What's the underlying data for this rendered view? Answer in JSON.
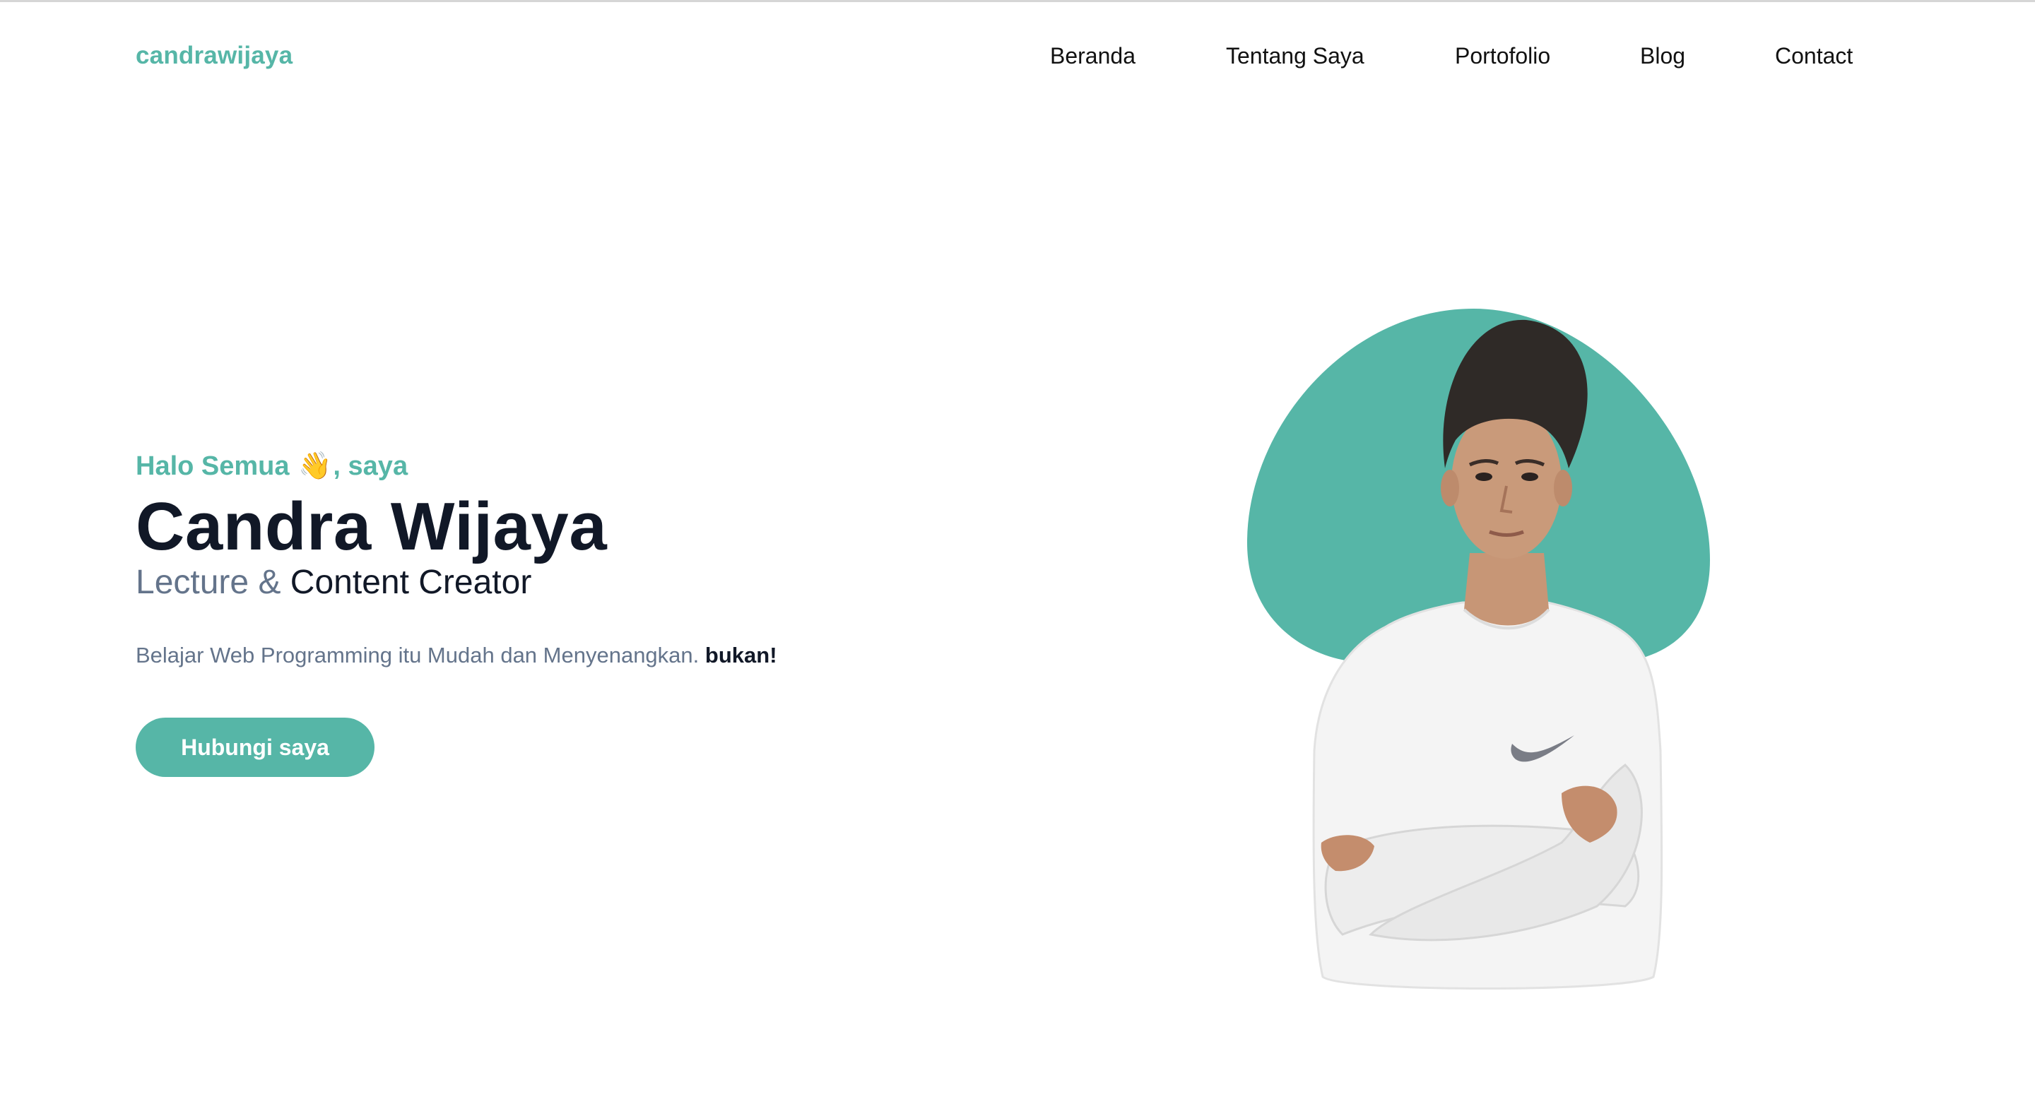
{
  "colors": {
    "accent": "#56b6a7",
    "heading": "#111827",
    "muted": "#64748b",
    "text": "#111111",
    "background": "#ffffff"
  },
  "navbar": {
    "logo": "candrawijaya",
    "links": [
      {
        "label": "Beranda"
      },
      {
        "label": "Tentang Saya"
      },
      {
        "label": "Portofolio"
      },
      {
        "label": "Blog"
      },
      {
        "label": "Contact"
      }
    ]
  },
  "hero": {
    "greeting_prefix": "Halo Semua",
    "greeting_emoji": "👋",
    "greeting_suffix": ", saya",
    "name": "Candra Wijaya",
    "role_part1": "Lecture &",
    "role_part2": "Content Creator",
    "tagline": "Belajar Web Programming itu Mudah dan Menyenangkan.",
    "tagline_emphasis": "bukan!",
    "cta_label": "Hubungi saya"
  },
  "portrait": {
    "icon": "person-photo",
    "blob_color": "#56b6a7"
  }
}
